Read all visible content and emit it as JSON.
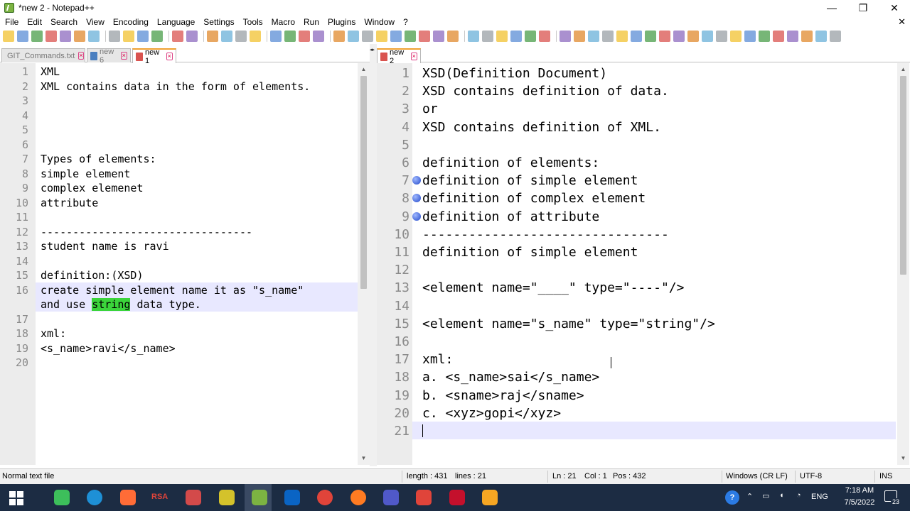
{
  "window": {
    "title": "*new 2 - Notepad++",
    "controls": {
      "minimize": "—",
      "restore": "❐",
      "close": "✕"
    }
  },
  "menu": [
    "File",
    "Edit",
    "Search",
    "View",
    "Encoding",
    "Language",
    "Settings",
    "Tools",
    "Macro",
    "Run",
    "Plugins",
    "Window",
    "?"
  ],
  "menu_close": "✕",
  "toolbar_icon_count": 56,
  "left_tabs": [
    {
      "label": "GIT_Commands.txt",
      "active": false
    },
    {
      "label": "new 6",
      "active": false
    },
    {
      "label": "new 1",
      "active": true
    }
  ],
  "right_tabs": [
    {
      "label": "new 2",
      "active": true
    }
  ],
  "left_editor": {
    "highlight_word": "string",
    "lines": [
      {
        "n": "1",
        "text": "XML"
      },
      {
        "n": "2",
        "text": "XML contains data in the form of elements."
      },
      {
        "n": "3",
        "text": ""
      },
      {
        "n": "4",
        "text": ""
      },
      {
        "n": "5",
        "text": ""
      },
      {
        "n": "6",
        "text": ""
      },
      {
        "n": "7",
        "text": "Types of elements:"
      },
      {
        "n": "8",
        "text": "simple element"
      },
      {
        "n": "9",
        "text": "complex elemenet"
      },
      {
        "n": "10",
        "text": "attribute"
      },
      {
        "n": "11",
        "text": ""
      },
      {
        "n": "12",
        "text": "---------------------------------"
      },
      {
        "n": "13",
        "text": "student name is ravi"
      },
      {
        "n": "14",
        "text": ""
      },
      {
        "n": "15",
        "text": "definition:(XSD)"
      },
      {
        "n": "16",
        "text": "create simple element name it as \"s_name\""
      },
      {
        "n": "",
        "text": "and use string data type."
      },
      {
        "n": "17",
        "text": ""
      },
      {
        "n": "18",
        "text": "xml:"
      },
      {
        "n": "19",
        "text": "<s_name>ravi</s_name>"
      },
      {
        "n": "20",
        "text": ""
      }
    ]
  },
  "right_editor": {
    "lines": [
      {
        "n": "1",
        "text": "XSD(Definition Document)"
      },
      {
        "n": "2",
        "text": "XSD contains definition of data."
      },
      {
        "n": "3",
        "text": "or"
      },
      {
        "n": "4",
        "text": "XSD contains definition of XML."
      },
      {
        "n": "5",
        "text": ""
      },
      {
        "n": "6",
        "text": "definition of elements:"
      },
      {
        "n": "7",
        "text": "definition of simple element",
        "bookmark": true
      },
      {
        "n": "8",
        "text": "definition of complex element",
        "bookmark": true
      },
      {
        "n": "9",
        "text": "definition of attribute",
        "bookmark": true
      },
      {
        "n": "10",
        "text": "--------------------------------"
      },
      {
        "n": "11",
        "text": "definition of simple element"
      },
      {
        "n": "12",
        "text": ""
      },
      {
        "n": "13",
        "text": "<element name=\"____\" type=\"----\"/>"
      },
      {
        "n": "14",
        "text": ""
      },
      {
        "n": "15",
        "text": "<element name=\"s_name\" type=\"string\"/>"
      },
      {
        "n": "16",
        "text": ""
      },
      {
        "n": "17",
        "text": "xml:"
      },
      {
        "n": "18",
        "text": "a. <s_name>sai</s_name>"
      },
      {
        "n": "19",
        "text": "b. <sname>raj</sname>"
      },
      {
        "n": "20",
        "text": "c. <xyz>gopi</xyz>"
      },
      {
        "n": "21",
        "text": ""
      }
    ]
  },
  "status": {
    "file_type": "Normal text file",
    "length": "length : 431",
    "lines": "lines : 21",
    "ln": "Ln : 21",
    "col": "Col : 1",
    "pos": "Pos : 432",
    "eol": "Windows (CR LF)",
    "encoding": "UTF-8",
    "mode": "INS"
  },
  "taskbar": {
    "apps": [
      "windows-start",
      "file-manager",
      "edge",
      "postman",
      "rsa",
      "paint",
      "fruit-app",
      "notepad++",
      "outlook",
      "chrome",
      "firefox",
      "teams",
      "media-player",
      "foxit",
      "settings-app"
    ],
    "rsa_label": "RSA",
    "language": "ENG",
    "time": "7:18 AM",
    "date": "7/5/2022",
    "notifications": "23"
  },
  "colors": {
    "line_highlight": "#e8e8ff",
    "word_highlight": "#3bd43b",
    "gutter": "#ececec",
    "taskbar": "#1c2c43"
  }
}
